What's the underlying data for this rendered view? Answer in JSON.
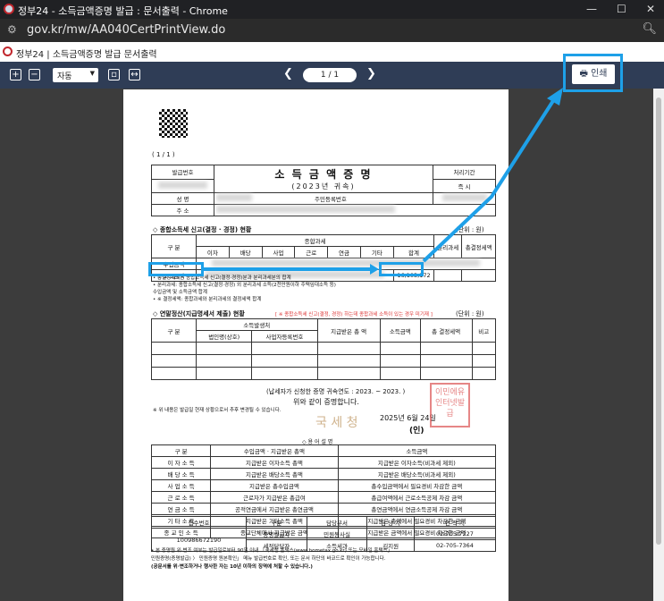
{
  "window": {
    "title": "정부24 - 소득금액증명 발급 : 문서출력 - Chrome"
  },
  "address": {
    "url": "gov.kr/mw/AA040CertPrintView.do"
  },
  "app": {
    "title": "정부24 | 소득금액증명 발급 문서출력"
  },
  "toolbar": {
    "zoom_value": "자동",
    "page_current": "1",
    "page_sep": "/",
    "page_total": "1",
    "print_label": "인쇄"
  },
  "doc": {
    "page_label": "( 1 / 1 )",
    "issue_no_label": "발급번호",
    "title": "소 득 금 액 증 명",
    "subtitle": "(2023년 귀속)",
    "period_label": "처리기간",
    "period_value": "즉 시",
    "name_label": "성 명",
    "rrn_label": "주민등록번호",
    "addr_label": "주 소",
    "sec1": "◇ 종합소득세 신고(결정 · 경정) 현황",
    "unit": "(단위 : 원)",
    "type_label": "구 분",
    "income_total_label": "종합과세",
    "cols": [
      "이자",
      "배당",
      "사업",
      "근로",
      "연금",
      "기타",
      "합계"
    ],
    "sep_label": "분리과세",
    "tax_label": "총결정세액",
    "row1": "수입금액",
    "row2": "소득금액",
    "income_value": "16,103,172",
    "notes": [
      "• 총결정세액은 종합소득세 신고(결정·경정)분과 분리과세분의 합계",
      "• 분리과세: 종합소득세 신고(결정·경정) 외 분리과세 소득(2천만원이하 주택임대소득 등)",
      "  수입금액 및 소득금액 합계",
      "• ※ 결정세액: 종합과세와 분리과세의 결정세액 합계"
    ],
    "sec2": "◇ 연말정산(지급명세서 제출) 현황",
    "sec2_note": "[ ※ 종합소득세 신고(결정, 경정) 하는데 종합과세 소득이 있는 경우 미기재 ]",
    "t2_cols": [
      "구 분",
      "소득발생처",
      "지급받은 총 액",
      "소득금액",
      "총 결정세액",
      "비고"
    ],
    "t2_sub": [
      "법인명(상호)",
      "사업자등록번호"
    ],
    "period_text": "(납세자가 신청한 증명 귀속연도 : 2023. ~ 2023. )",
    "certify": "위와 같이 증명합니다.",
    "warning": "※ 위 내용은 발급일 현재 상황으로서 추후 변경될 수 있습니다.",
    "date": "2025년 6월 24일",
    "agency": "국 세 청",
    "seal": "(인)",
    "stamp": "이민에유 인터넷발급",
    "explain_title": "◇ 용 어 설 명",
    "explain_cols": [
      "구 분",
      "수입금액 · 지급받은 총액",
      "소득금액"
    ],
    "explain_rows": [
      [
        "이 자 소 득",
        "지급받은 이자소득 총액",
        "지급받은 이자소득(비과세 제외)"
      ],
      [
        "배 당 소 득",
        "지급받은 배당소득 총액",
        "지급받은 배당소득(비과세 제외)"
      ],
      [
        "사 업 소 득",
        "지급받은 총수입금액",
        "총수입금액에서 필요경비 차감한 금액"
      ],
      [
        "근 로 소 득",
        "근로자가 지급받은 총급여",
        "총급여액에서 근로소득공제 차감 금액"
      ],
      [
        "연 금 소 득",
        "공적연금에서 지급받은 총연금액",
        "총연금액에서 연금소득공제 차감 금액"
      ],
      [
        "기 타 소 득",
        "지급받은 기타소득 총액",
        "지급받은 총액에서 필요경비 차감한 금액"
      ],
      [
        "종 교 인 소 득",
        "종교단체에서 지급받은 금액",
        "지급받은 금액에서 필요경비 차감한 금액"
      ]
    ],
    "contact_cols": [
      "접수번호",
      "구분",
      "담당부서",
      "담 당 자",
      "연 락 처"
    ],
    "receipt_no": "100986672190",
    "contact_rows": [
      [
        "증명발급자",
        "민원봉사실",
        "",
        "02-705-7227"
      ],
      [
        "세적담당자",
        "소득세과",
        "김지원",
        "02-705-7364"
      ]
    ],
    "footer": [
      "• 본 증명원 위·변조 여부는 발급일로부터 90일 이내 「국세청 홈택스(www.hometax.go.kr) 또는 모바일 홈택스」",
      "  민원증명(증명발급) 〉 민원증명 원본확인」 메뉴 발급번호로 확인, 또는 문서 하단의 바코드로 확인이 가능합니다.",
      "(공문서를 위·변조하거나 행사한 자는 10년 이하의 징역에 처할 수 있습니다.)"
    ]
  }
}
